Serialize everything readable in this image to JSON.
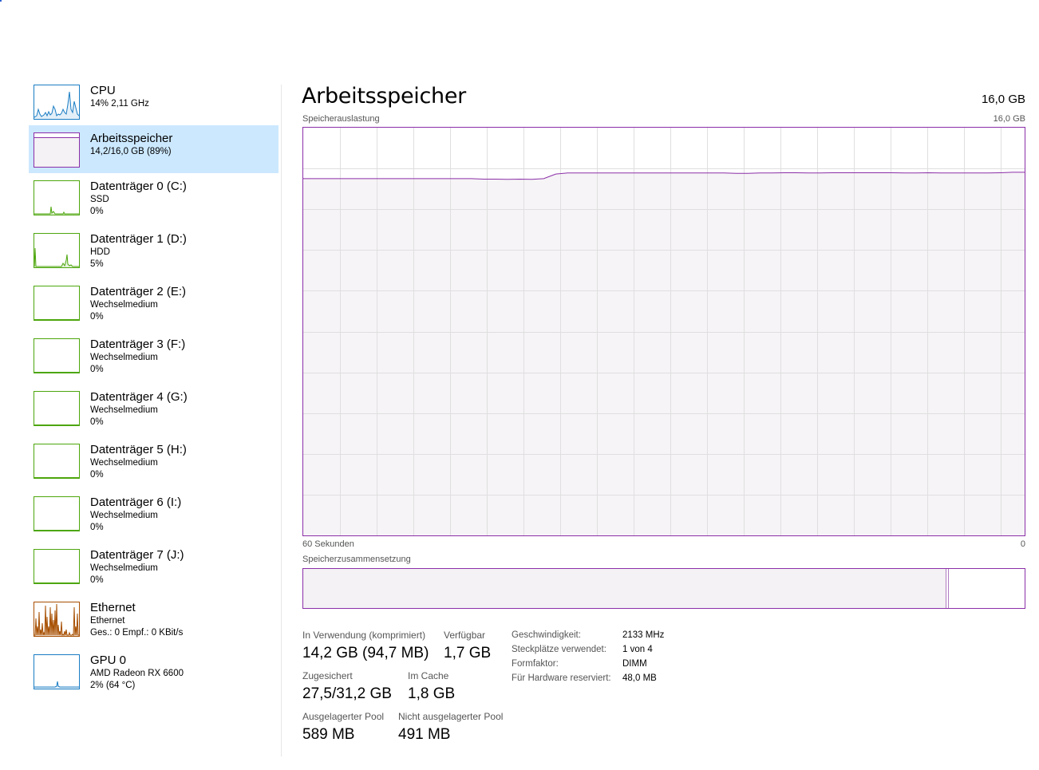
{
  "colors": {
    "cpu": "#1a7dc4",
    "memory": "#8b2fa8",
    "disk": "#4da60c",
    "ethernet": "#a74f01",
    "gpu": "#1a7dc4",
    "selected_bg": "#cce8ff",
    "chart_fill": "#f4f2f4",
    "grid": "#e0dfe0"
  },
  "sidebar": {
    "items": [
      {
        "title": "CPU",
        "line1": "14% 2,11 GHz",
        "line2": "",
        "icon": "cpu-graph",
        "color": "#1a7dc4"
      },
      {
        "title": "Arbeitsspeicher",
        "line1": "14,2/16,0 GB (89%)",
        "line2": "",
        "icon": "memory-graph",
        "color": "#8b2fa8",
        "level": 0.89
      },
      {
        "title": "Datenträger 0 (C:)",
        "line1": "SSD",
        "line2": "0%",
        "icon": "disk-graph",
        "color": "#4da60c"
      },
      {
        "title": "Datenträger 1 (D:)",
        "line1": "HDD",
        "line2": "5%",
        "icon": "disk-graph",
        "color": "#4da60c"
      },
      {
        "title": "Datenträger 2 (E:)",
        "line1": "Wechselmedium",
        "line2": "0%",
        "icon": "disk-graph",
        "color": "#4da60c"
      },
      {
        "title": "Datenträger 3 (F:)",
        "line1": "Wechselmedium",
        "line2": "0%",
        "icon": "disk-graph",
        "color": "#4da60c"
      },
      {
        "title": "Datenträger 4 (G:)",
        "line1": "Wechselmedium",
        "line2": "0%",
        "icon": "disk-graph",
        "color": "#4da60c"
      },
      {
        "title": "Datenträger 5 (H:)",
        "line1": "Wechselmedium",
        "line2": "0%",
        "icon": "disk-graph",
        "color": "#4da60c"
      },
      {
        "title": "Datenträger 6 (I:)",
        "line1": "Wechselmedium",
        "line2": "0%",
        "icon": "disk-graph",
        "color": "#4da60c"
      },
      {
        "title": "Datenträger 7 (J:)",
        "line1": "Wechselmedium",
        "line2": "0%",
        "icon": "disk-graph",
        "color": "#4da60c"
      },
      {
        "title": "Ethernet",
        "line1": "Ethernet",
        "line2": "Ges.: 0 Empf.: 0 KBit/s",
        "icon": "ethernet-graph",
        "color": "#a74f01"
      },
      {
        "title": "GPU 0",
        "line1": "AMD Radeon RX 6600",
        "line2": "2% (64 °C)",
        "icon": "gpu-graph",
        "color": "#1a7dc4"
      }
    ]
  },
  "main": {
    "title": "Arbeitsspeicher",
    "total": "16,0 GB",
    "usage_label": "Speicherauslastung",
    "usage_max": "16,0 GB",
    "time_left": "60 Sekunden",
    "time_right": "0",
    "composition_label": "Speicherzusammensetzung",
    "composition": {
      "in_use_fraction": 0.892,
      "modified_fraction": 0.003
    }
  },
  "chart_data": {
    "type": "area",
    "title": "Speicherauslastung",
    "xlabel": "",
    "ylabel": "",
    "x_range_label": [
      "60 Sekunden",
      "0"
    ],
    "ylim": [
      0,
      16.0
    ],
    "grid": true,
    "series": [
      {
        "values": [
          14.0,
          14.0,
          14.0,
          14.0,
          14.0,
          14.0,
          14.0,
          14.0,
          14.0,
          14.0,
          14.0,
          14.0,
          14.0,
          14.0,
          14.0,
          13.98,
          13.98,
          13.97,
          13.98,
          13.97,
          14.0,
          14.18,
          14.22,
          14.22,
          14.22,
          14.22,
          14.22,
          14.22,
          14.22,
          14.22,
          14.22,
          14.22,
          14.22,
          14.22,
          14.22,
          14.22,
          14.21,
          14.21,
          14.22,
          14.22,
          14.23,
          14.23,
          14.22,
          14.22,
          14.23,
          14.23,
          14.23,
          14.23,
          14.23,
          14.23,
          14.22,
          14.22,
          14.23,
          14.22,
          14.22,
          14.22,
          14.22,
          14.22,
          14.23,
          14.25,
          14.25
        ]
      }
    ]
  },
  "stats": {
    "in_use_label": "In Verwendung (komprimiert)",
    "in_use_value": "14,2 GB (94,7 MB)",
    "available_label": "Verfügbar",
    "available_value": "1,7 GB",
    "committed_label": "Zugesichert",
    "committed_value": "27,5/31,2 GB",
    "cached_label": "Im Cache",
    "cached_value": "1,8 GB",
    "paged_label": "Ausgelagerter Pool",
    "paged_value": "589 MB",
    "nonpaged_label": "Nicht ausgelagerter Pool",
    "nonpaged_value": "491 MB"
  },
  "info": {
    "speed_label": "Geschwindigkeit:",
    "speed_value": "2133 MHz",
    "slots_label": "Steckplätze verwendet:",
    "slots_value": "1 von 4",
    "form_label": "Formfaktor:",
    "form_value": "DIMM",
    "reserved_label": "Für Hardware reserviert:",
    "reserved_value": "48,0 MB"
  }
}
